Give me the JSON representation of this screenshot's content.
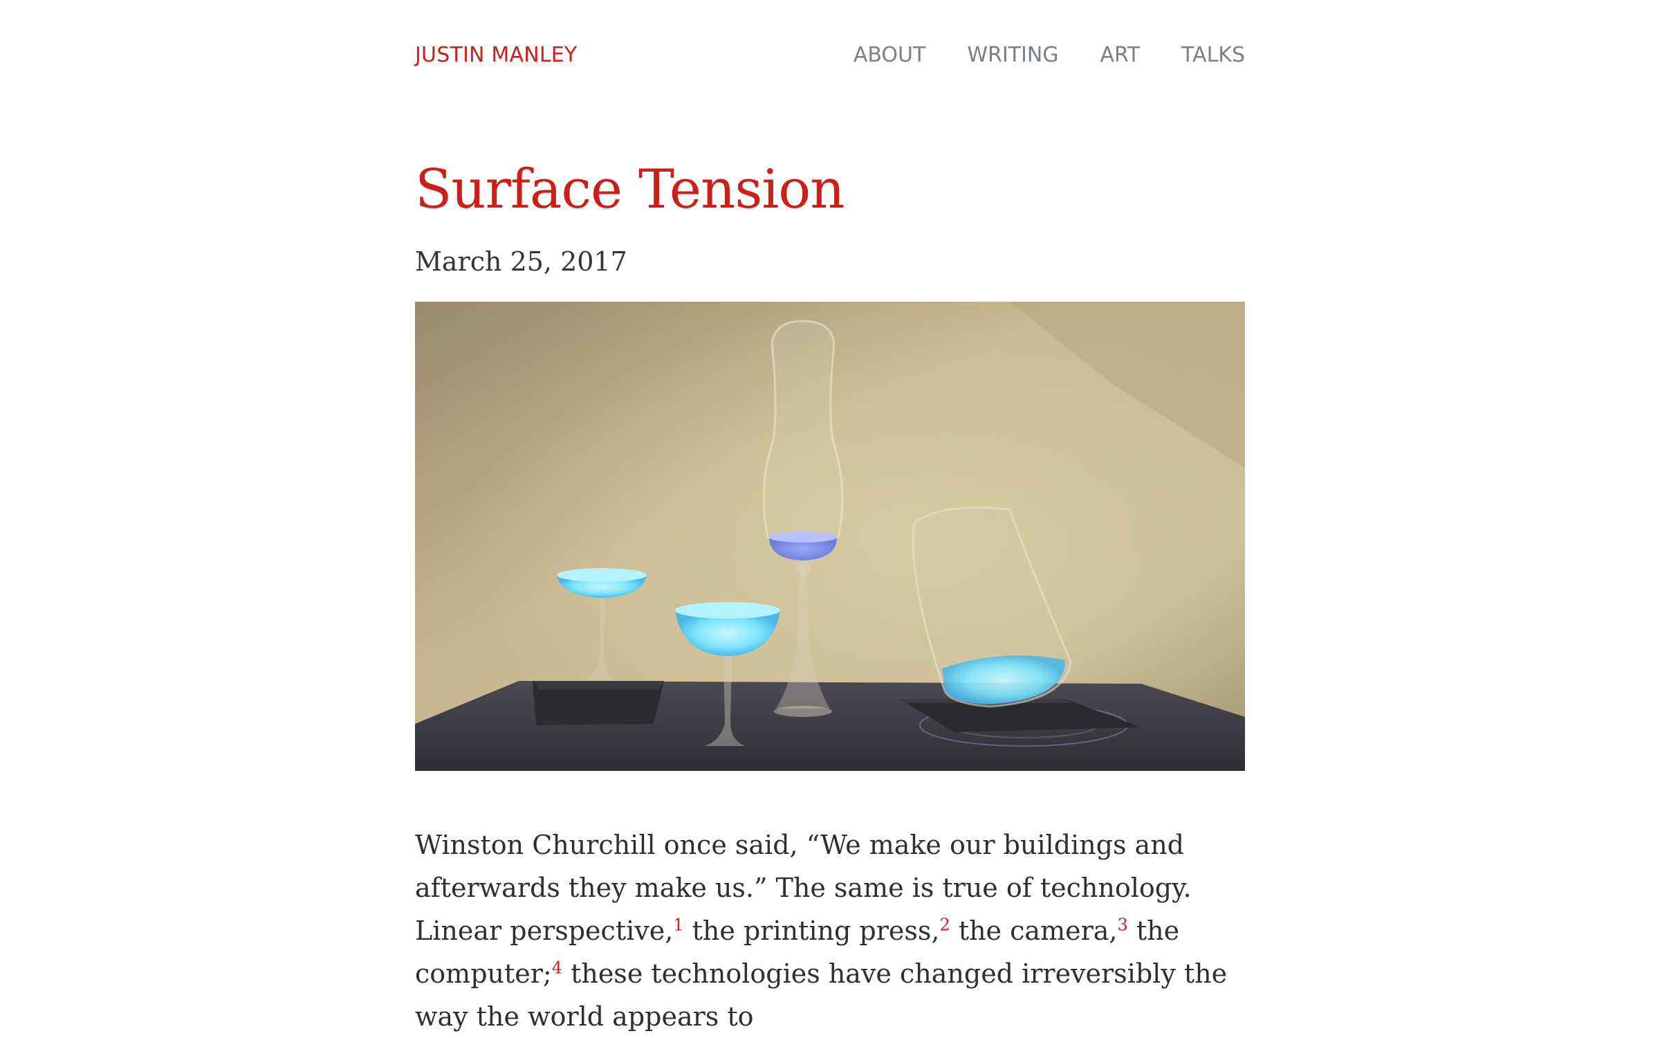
{
  "header": {
    "site_title": "JUSTIN MANLEY",
    "nav": [
      "ABOUT",
      "WRITING",
      "ART",
      "TALKS"
    ]
  },
  "post": {
    "title": "Surface Tension",
    "date": "March 25, 2017",
    "body": {
      "t1": "Winston Churchill once said, “We make our buildings and afterwards they make us.” The same is true of technology. Linear perspective,",
      "fn1": "1",
      "t2": " the printing press,",
      "fn2": "2",
      "t3": " the camera,",
      "fn3": "3",
      "t4": " the computer;",
      "fn4": "4",
      "t5": " these technologies have changed irreversibly the way the world appears to"
    }
  },
  "colors": {
    "accent": "#cc1f1a",
    "nav": "#7a8088",
    "text": "#2d2f33",
    "photo_wall": "#c4b48e",
    "photo_table": "#3e3d44",
    "glow": "#7fe6ff"
  }
}
